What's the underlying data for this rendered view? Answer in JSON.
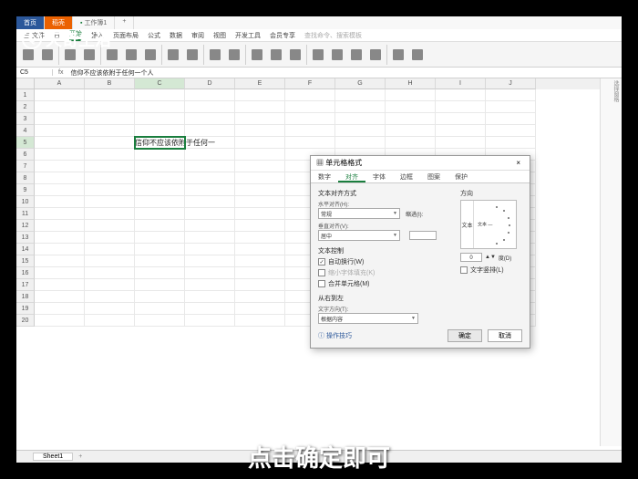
{
  "logo": {
    "text": "天奇生活",
    "icon": "Q"
  },
  "titlebar": {
    "tabs": [
      {
        "label": "首页"
      },
      {
        "label": "稻壳"
      },
      {
        "label": "工作簿1"
      }
    ]
  },
  "menu": {
    "items": [
      "三 文件",
      "日",
      "开始",
      "插入",
      "页面布局",
      "公式",
      "数据",
      "审阅",
      "视图",
      "开发工具",
      "会员专享",
      "查找命令、搜索模板"
    ]
  },
  "formulabar": {
    "cellref": "C5",
    "fx": "fx",
    "text": "信仰不应该依附于任何一个人"
  },
  "columns": [
    "A",
    "B",
    "C",
    "D",
    "E",
    "F",
    "G",
    "H",
    "I",
    "J"
  ],
  "cellC5": "信仰不应该依附于任何一",
  "sheettab": "Sheet1",
  "taskpane_title": "选择窗格",
  "dialog": {
    "title": "单元格格式",
    "tabs": [
      "数字",
      "对齐",
      "字体",
      "边框",
      "图案",
      "保护"
    ],
    "active_tab": "对齐",
    "text_align_label": "文本对齐方式",
    "horiz_label": "水平对齐(H):",
    "horiz_value": "常规",
    "indent_label": "缩进(I):",
    "vert_label": "垂直对齐(V):",
    "vert_value": "居中",
    "textctrl_label": "文本控制",
    "wrap_label": "自动换行(W)",
    "shrink_label": "缩小字体填充(K)",
    "merge_label": "合并单元格(M)",
    "rtl_label": "从右到左",
    "dir_label": "文字方向(T):",
    "dir_value": "根据内容",
    "orient_label": "方向",
    "orient_vtext": "文本",
    "orient_htext": "文本 —",
    "deg_value": "0",
    "deg_unit": "度(D)",
    "stack_label": "文字竖排(L)",
    "help": "操作技巧",
    "ok": "确定",
    "cancel": "取消"
  },
  "subtitle": "点击确定即可"
}
